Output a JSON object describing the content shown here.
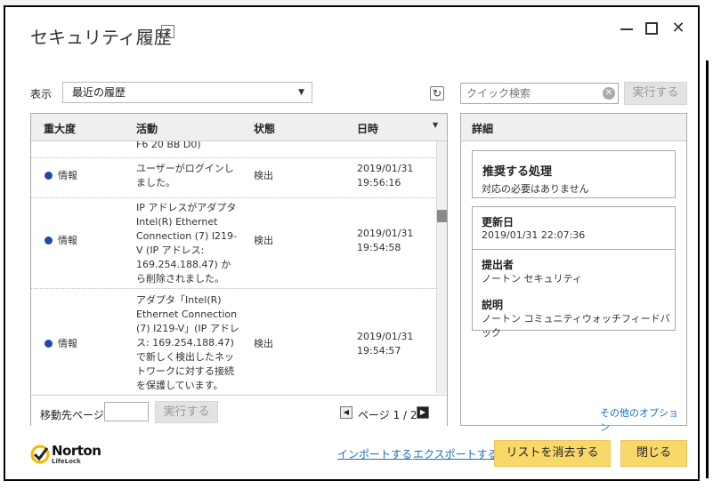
{
  "window": {
    "title": "セキュリティ履歴",
    "help": "?"
  },
  "filter": {
    "show_label": "表示",
    "selected": "最近の履歴"
  },
  "search": {
    "placeholder": "クイック検索",
    "run_label": "実行する"
  },
  "list": {
    "headers": {
      "severity": "重大度",
      "activity": "活動",
      "status": "状態",
      "datetime": "日時"
    },
    "partial_row_text": "F6 20 BB D0)",
    "rows": [
      {
        "severity": "情報",
        "activity": "ユーザーがログインしました。",
        "status": "検出",
        "date": "2019/01/31",
        "time": "19:56:16"
      },
      {
        "severity": "情報",
        "activity": "IP アドレスがアダプタ Intel(R) Ethernet Connection (7) I219-V (IP アドレス: 169.254.188.47) から削除されました。",
        "status": "検出",
        "date": "2019/01/31",
        "time": "19:54:58"
      },
      {
        "severity": "情報",
        "activity": "アダプタ「Intel(R) Ethernet Connection (7) I219-V」(IP アドレス: 169.254.188.47) で新しく検出したネットワークに対する接続を保護しています。",
        "status": "検出",
        "date": "2019/01/31",
        "time": "19:54:57"
      }
    ],
    "severity_color": "#2247a8",
    "footer": {
      "goto_label": "移動先ページ:",
      "run_label": "実行する",
      "page_text": "ページ 1 / 2"
    }
  },
  "detail": {
    "header": "詳細",
    "recommended_title": "推奨する処理",
    "recommended_value": "対応の必要はありません",
    "updated_label": "更新日",
    "updated_value": "2019/01/31 22:07:36",
    "provider_label": "提出者",
    "provider_value": "ノートン セキュリティ",
    "desc_label": "説明",
    "desc_value": "ノートン コミュニティウォッチフィードバック",
    "more_options": "その他のオプション"
  },
  "footer": {
    "brand": "Norton",
    "brand_sub": "LifeLock",
    "import": "インポートする",
    "export": "エクスポートする",
    "clear": "リストを消去する",
    "close": "閉じる"
  },
  "icons": [
    "help-icon",
    "minimize-icon",
    "maximize-icon",
    "close-icon",
    "dropdown-caret-icon",
    "refresh-icon",
    "clear-search-icon",
    "sort-caret-icon",
    "prev-page-icon",
    "next-page-icon",
    "norton-check-icon"
  ],
  "colors": {
    "accent_button": "#f9d86a",
    "link": "#1a6fc4"
  }
}
